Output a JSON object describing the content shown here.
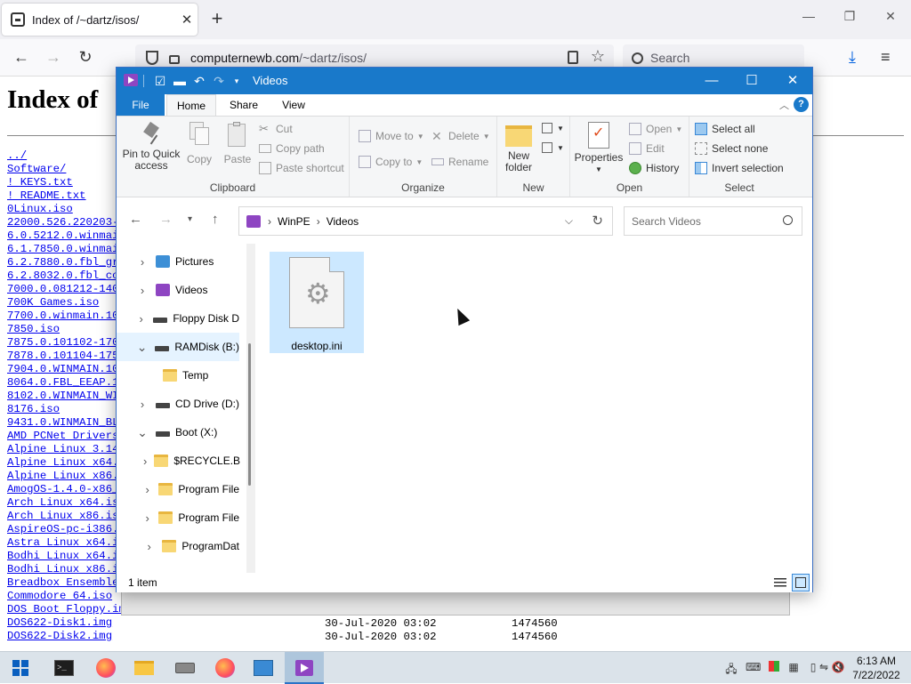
{
  "browser": {
    "tab_title": "Index of /~dartz/isos/",
    "url_host": "computernewb.com",
    "url_path": "/~dartz/isos/",
    "search_placeholder": "Search",
    "close_symbol": "✕",
    "new_tab_symbol": "+"
  },
  "page": {
    "heading": "Index of",
    "files": [
      "../",
      "Software/",
      "! KEYS.txt",
      "! README.txt",
      "0Linux.iso",
      "22000.526.220203-1",
      "6.0.5212.0.winmain",
      "6.1.7850.0.winmain",
      "6.2.7880.0.fbl_gr",
      "6.2.8032.0.fbl_co",
      "7000.0.081212-140",
      "700K Games.iso",
      "7700.0.winmain.100",
      "7850.iso",
      "7875.0.101102-170",
      "7878.0.101104-175",
      "7904.0.WINMAIN.101",
      "8064.0.FBL_EEAP.1",
      "8102.0.WINMAIN_WI",
      "8176.iso",
      "9431.0.WINMAIN_BL",
      "AMD PCNet Drivers",
      "Alpine Linux 3.14",
      "Alpine Linux x64.",
      "Alpine Linux x86.",
      "AmogOS-1.4.0-x86_",
      "Arch Linux x64.iso",
      "Arch Linux x86.iso",
      "AspireOS-pc-i386.",
      "Astra Linux x64.is",
      "Bodhi Linux x64.is",
      "Bodhi Linux x86.is",
      "Breadbox Ensemble",
      "Commodore 64.iso",
      "DOS Boot Floppy.im",
      "DOS622-Disk1.img",
      "DOS622-Disk2.img"
    ],
    "row1_date": "30-Jul-2020 03:02",
    "row1_size": "1474560",
    "row2_date": "30-Jul-2020 03:02",
    "row2_size": "1474560"
  },
  "explorer": {
    "title": "Videos",
    "tabs": {
      "file": "File",
      "home": "Home",
      "share": "Share",
      "view": "View"
    },
    "ribbon": {
      "clipboard": {
        "label": "Clipboard",
        "pin": "Pin to Quick access",
        "copy": "Copy",
        "paste": "Paste",
        "cut": "Cut",
        "copy_path": "Copy path",
        "paste_shortcut": "Paste shortcut"
      },
      "organize": {
        "label": "Organize",
        "move_to": "Move to",
        "copy_to": "Copy to",
        "delete": "Delete",
        "rename": "Rename"
      },
      "new": {
        "label": "New",
        "new_folder": "New folder"
      },
      "open": {
        "label": "Open",
        "properties": "Properties",
        "open": "Open",
        "edit": "Edit",
        "history": "History"
      },
      "select": {
        "label": "Select",
        "select_all": "Select all",
        "select_none": "Select none",
        "invert": "Invert selection"
      }
    },
    "address": {
      "crumb1": "WinPE",
      "crumb2": "Videos"
    },
    "search_placeholder": "Search Videos",
    "nav": [
      {
        "label": "Pictures",
        "icon": "pictures-icon",
        "expanded": false
      },
      {
        "label": "Videos",
        "icon": "videos-icon",
        "expanded": false
      },
      {
        "label": "Floppy Disk D",
        "icon": "floppy-drive-icon",
        "expanded": false
      },
      {
        "label": "RAMDisk (B:)",
        "icon": "drive-icon",
        "expanded": true
      },
      {
        "label": "Temp",
        "icon": "folder-icon",
        "expanded": false
      },
      {
        "label": "CD Drive (D:)",
        "icon": "cd-drive-icon",
        "expanded": false
      },
      {
        "label": "Boot (X:)",
        "icon": "drive-icon",
        "expanded": true
      },
      {
        "label": "$RECYCLE.B",
        "icon": "folder-icon",
        "expanded": false
      },
      {
        "label": "Program File",
        "icon": "folder-icon",
        "expanded": false
      },
      {
        "label": "Program File",
        "icon": "folder-icon",
        "expanded": false
      },
      {
        "label": "ProgramDat",
        "icon": "folder-icon",
        "expanded": false
      }
    ],
    "files": [
      {
        "name": "desktop.ini",
        "icon": "settings-file-icon"
      }
    ],
    "status": "1 item"
  },
  "taskbar": {
    "time": "6:13 AM",
    "date": "7/22/2022"
  }
}
